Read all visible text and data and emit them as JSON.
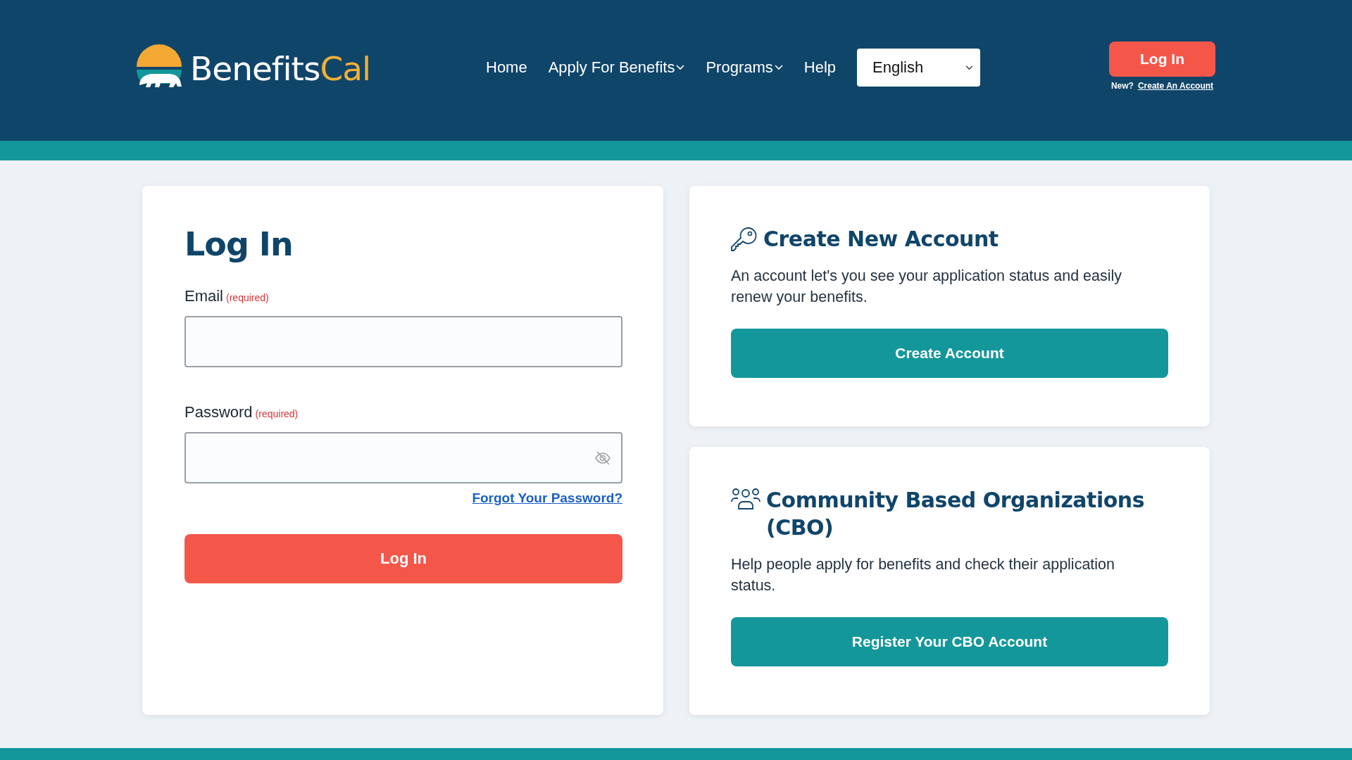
{
  "header": {
    "logo": {
      "brand_main": "Benefits",
      "brand_accent": "Cal"
    },
    "nav": [
      {
        "label": "Home",
        "has_dropdown": false
      },
      {
        "label": "Apply For Benefits",
        "has_dropdown": true
      },
      {
        "label": "Programs",
        "has_dropdown": true
      },
      {
        "label": "Help",
        "has_dropdown": false
      }
    ],
    "language": {
      "value": "English"
    },
    "login_button": "Log In",
    "new_account": {
      "prompt": "New?",
      "link": "Create An Account"
    }
  },
  "login_card": {
    "title": "Log In",
    "fields": [
      {
        "kind": "email",
        "label": "Email",
        "required_note": "(required)"
      },
      {
        "kind": "password",
        "label": "Password",
        "required_note": "(required)"
      }
    ],
    "forgot_link": "Forgot Your Password?",
    "submit": "Log In"
  },
  "cards": [
    {
      "kind": "key",
      "title": "Create New Account",
      "description": "An account let's you see your application status and easily renew your benefits.",
      "button": "Create Account"
    },
    {
      "kind": "people",
      "title": "Community Based Organizations (CBO)",
      "description": "Help people apply for benefits and check their application status.",
      "button": "Register Your CBO Account"
    }
  ]
}
